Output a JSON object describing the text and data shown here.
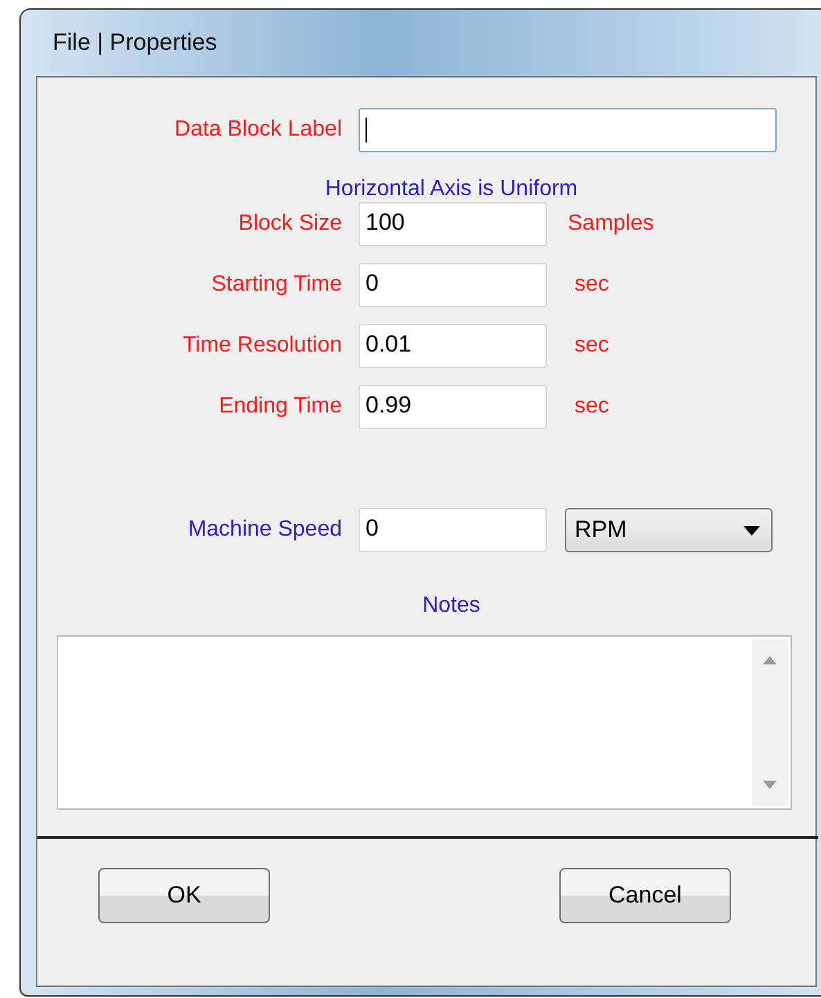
{
  "window": {
    "title": "File | Properties"
  },
  "label_field": {
    "label": "Data Block Label",
    "focused": true
  },
  "axis_note": "Horizontal Axis is Uniform",
  "fields": [
    {
      "label": "Block Size",
      "value": "100",
      "unit": "Samples"
    },
    {
      "label": "Starting Time",
      "value": "0",
      "unit": "sec"
    },
    {
      "label": "Time Resolution",
      "value": "0.01",
      "unit": "sec"
    },
    {
      "label": "Ending Time",
      "value": "0.99",
      "unit": "sec"
    }
  ],
  "speed": {
    "label": "Machine Speed",
    "value": "0",
    "unit": "RPM"
  },
  "notes": {
    "label": "Notes"
  },
  "buttons": [
    "OK",
    "Cancel"
  ]
}
